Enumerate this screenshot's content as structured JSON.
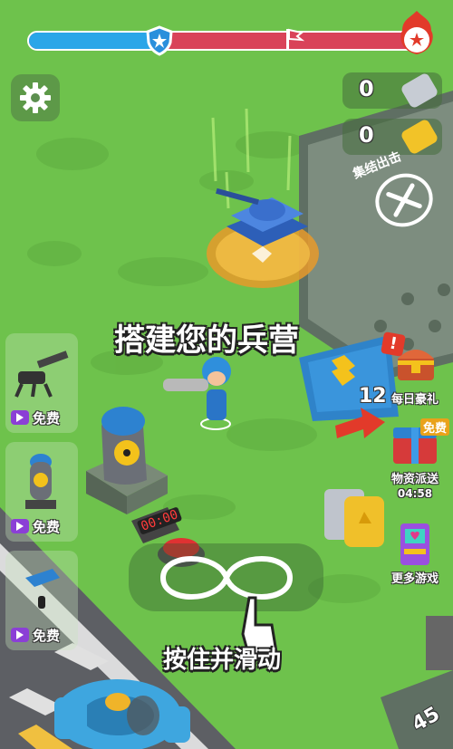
{
  "progress": {
    "level": 0.36,
    "colors": {
      "done": "#2aa6e8",
      "remaining": "#d94359"
    }
  },
  "settings": {
    "icon": "gear-icon"
  },
  "counters": [
    {
      "value": "0",
      "icon": "silver-ticket-icon"
    },
    {
      "value": "0",
      "icon": "gold-ticket-icon"
    }
  ],
  "rally": {
    "label": "集结出击",
    "icon": "crossed-rifles-icon"
  },
  "hint": {
    "build_text": "搭建您的兵营",
    "swipe_text": "按住并滑动"
  },
  "barracks_count": "12",
  "timer_display": "00:00",
  "stack_count": "45",
  "side_items": [
    {
      "name": "gatling-turret",
      "label": "免费"
    },
    {
      "name": "nuclear-bomb",
      "label": "免费"
    },
    {
      "name": "drone",
      "label": "免费"
    }
  ],
  "right_buttons": [
    {
      "label": "每日豪礼",
      "badge": "!"
    },
    {
      "label": "物资派送",
      "tag": "免费",
      "timer": "04:58"
    },
    {
      "label": "更多游戏"
    }
  ]
}
